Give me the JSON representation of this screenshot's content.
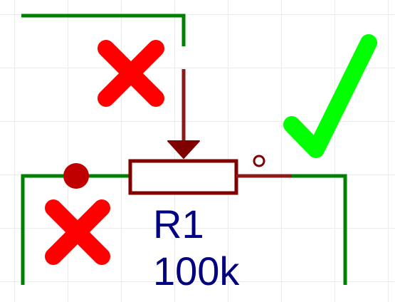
{
  "component": {
    "designator": "R1",
    "value": "100k"
  },
  "colors": {
    "wire": "#008000",
    "component_body": "#800000",
    "unconnected_pin": "#800000",
    "junction_dot": "#c00000",
    "designator_text": "#000080",
    "wrong_mark": "#ff0000",
    "correct_mark": "#00ff00",
    "grid": "#ebebeb"
  },
  "markers": [
    {
      "name": "wiper-wrong-mark",
      "kind": "cross",
      "meaning": "incorrect"
    },
    {
      "name": "left-pin-wrong-mark",
      "kind": "cross",
      "meaning": "incorrect"
    },
    {
      "name": "right-pin-correct-mark",
      "kind": "check",
      "meaning": "correct"
    }
  ]
}
